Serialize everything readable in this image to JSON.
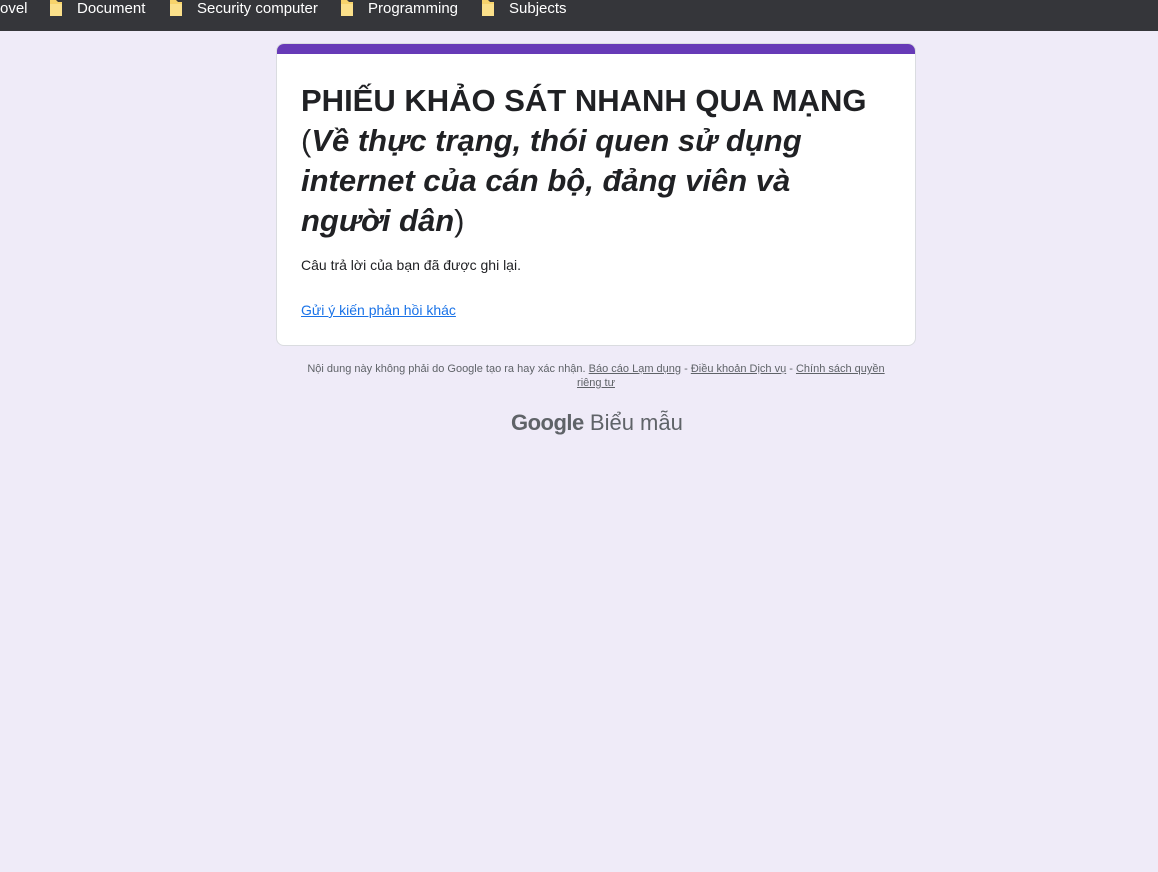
{
  "bookmarks": [
    {
      "label": "ovel",
      "icon": "folder-icon"
    },
    {
      "label": "Document",
      "icon": "folder-icon"
    },
    {
      "label": "Security computer",
      "icon": "folder-icon"
    },
    {
      "label": "Programming",
      "icon": "folder-icon"
    },
    {
      "label": "Subjects",
      "icon": "folder-icon"
    }
  ],
  "form": {
    "accent_color": "#673ab7",
    "title_main": "PHIẾU KHẢO SÁT NHANH QUA MẠNG ",
    "title_open_paren": "(",
    "title_italic": "Về thực trạng, thói quen sử dụng internet của cán bộ, đảng viên và người dân",
    "title_close_paren": ")",
    "confirmation_message": "Câu trả lời của bạn đã được ghi lại.",
    "submit_another_link": "Gửi ý kiến phản hồi khác"
  },
  "footer": {
    "disclaimer": "Nội dung này không phải do Google tạo ra hay xác nhận.",
    "report_abuse": "Báo cáo Lạm dụng",
    "separator_1": " - ",
    "terms": "Điều khoản Dịch vụ",
    "separator_2": " - ",
    "privacy": "Chính sách quyền riêng tư",
    "brand_google": "Google",
    "brand_product": "Biểu mẫu"
  }
}
